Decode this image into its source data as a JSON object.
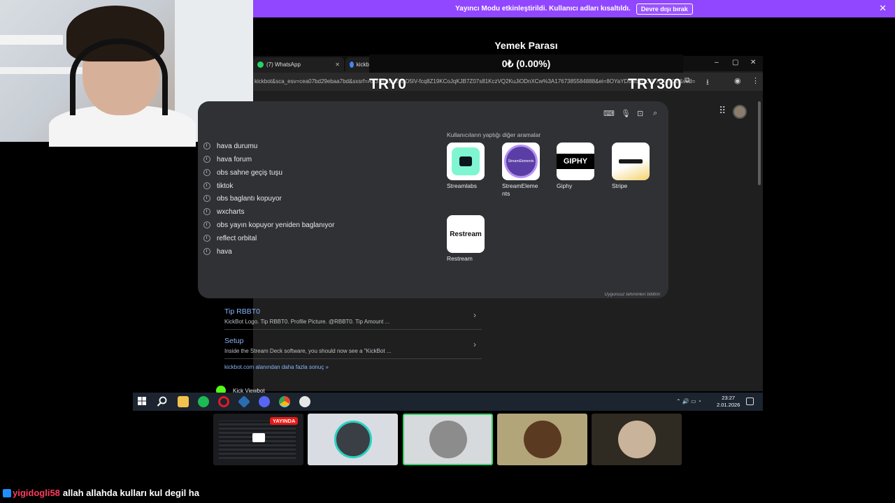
{
  "mode_bar": {
    "message": "Yayıncı Modu etkinleştirildi. Kullanıcı adları kısaltıldı.",
    "button": "Devre dışı bırak",
    "close_icon": "close-icon"
  },
  "overlay": {
    "title": "Yemek Parası",
    "amount": "0₺ (0.00%)",
    "left_label": "TRY0",
    "right_label": "TRY300",
    "progress_fraction": 0
  },
  "browser": {
    "tabs": [
      {
        "label": "(7) WhatsApp",
        "icon": "whatsapp-icon"
      },
      {
        "label": "kickb",
        "icon": "chrome-icon"
      }
    ],
    "url": "kickbot&sca_esv=cea07bd29ebaa7bd&sxsrf=AE3TifN8pfSfDD5lV-fcq8Z19KCoJqKJB7Z07s81KczVQ2KuJiODnXCw%3A1767385584888&ei=8OYaYD6NduIxc8P7ZKoyQ8&ved=",
    "search": {
      "suggestions": [
        "hava durumu",
        "hava forum",
        "obs sahne geçiş tuşu",
        "tiktok",
        "obs baglantı kopuyor",
        "wxcharts",
        "obs yayın kopuyor yeniden baglanıyor",
        "reflect orbital",
        "hava"
      ],
      "others_title": "Kullanıcıların yaptığı diğer aramalar",
      "others": [
        {
          "label": "Streamlabs",
          "logo_text": ""
        },
        {
          "label": "StreamElements",
          "logo_text": "StreamElements"
        },
        {
          "label": "Giphy",
          "logo_text": "GIPHY"
        },
        {
          "label": "Stripe",
          "logo_text": ""
        },
        {
          "label": "Restream",
          "logo_text": "Restream"
        }
      ],
      "report": "Uygunsuz tahminleri bildirin"
    },
    "results": [
      {
        "title": "Tip RBBT0",
        "desc": "KickBot Logo. Tip RBBT0. Profile Picture. @RBBT0. Tip Amount ..."
      },
      {
        "title": "Setup",
        "desc": "Inside the Stream Deck software, you should now see a \"KickBot ..."
      }
    ],
    "more_link": "kickbot.com alanından daha fazla sonuç »",
    "next_result": "Kick Viewbot"
  },
  "taskbar": {
    "apps": [
      "windows-start-icon",
      "search-icon",
      "file-explorer-icon",
      "spotify-icon",
      "opera-icon",
      "app-icon",
      "discord-icon",
      "chrome-icon",
      "obs-icon"
    ],
    "time": "23:27",
    "date": "2.01.2026"
  },
  "thumbnails": {
    "live_badge": "YAYINDA"
  },
  "chat": {
    "user": "yigidogli58",
    "message": "allah allahda kulları kul degil ha"
  },
  "colors": {
    "accent": "#9146ff",
    "live": "#e91916",
    "link": "#8ab4f8",
    "chat_user": "#ff3b5c"
  }
}
